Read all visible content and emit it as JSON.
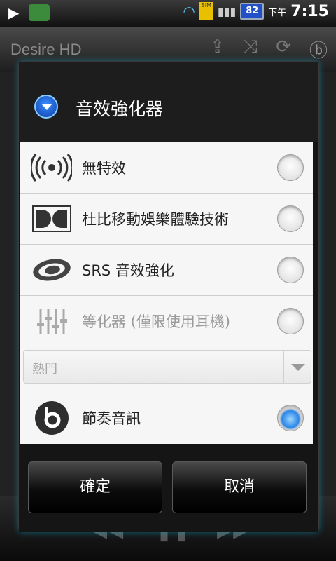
{
  "statusbar": {
    "ampm": "下午",
    "time": "7:15",
    "battery": "82",
    "sim_label": "SIM"
  },
  "app": {
    "title": "Desire HD",
    "top_icons": [
      "share-icon",
      "shuffle-icon",
      "repeat-icon",
      "beats-icon"
    ],
    "bottom_controls": [
      "previous-icon",
      "pause-icon",
      "next-icon"
    ]
  },
  "dialog": {
    "title": "音效強化器",
    "options": [
      {
        "label": "無特效",
        "icon": "broadcast-icon",
        "selected": false,
        "enabled": true
      },
      {
        "label": "杜比移動娛樂體驗技術",
        "icon": "dolby-icon",
        "selected": false,
        "enabled": true
      },
      {
        "label": "SRS 音效強化",
        "icon": "srs-icon",
        "selected": false,
        "enabled": true
      },
      {
        "label": "等化器 (僅限使用耳機)",
        "icon": "equalizer-icon",
        "selected": false,
        "enabled": false
      },
      {
        "label": "節奏音訊",
        "icon": "beats-audio-icon",
        "selected": true,
        "enabled": true
      }
    ],
    "preset_dropdown": {
      "value": "熱門",
      "enabled": false
    },
    "ok_label": "確定",
    "cancel_label": "取消"
  },
  "colors": {
    "accent": "#2a86e8",
    "dialog_bg": "#141414",
    "list_bg": "#f6f6f6"
  }
}
